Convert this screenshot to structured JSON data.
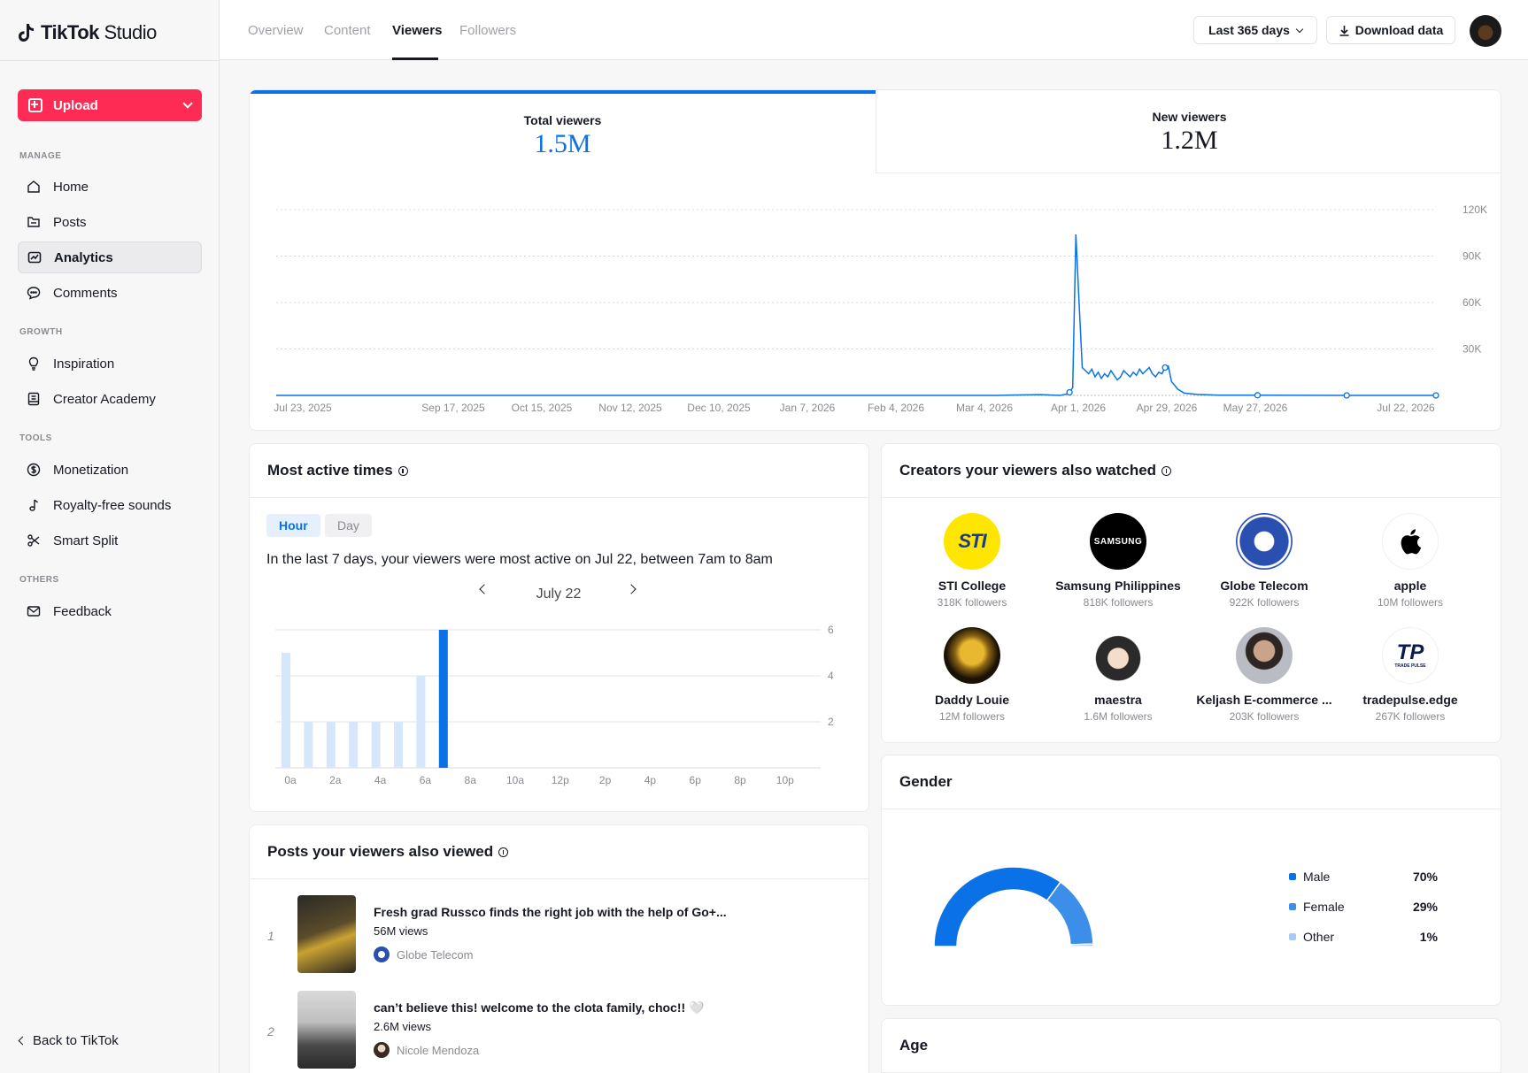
{
  "app": {
    "logo_text": "TikTok",
    "logo_suffix": "Studio"
  },
  "sidebar": {
    "upload_label": "Upload",
    "sections": {
      "manage": "MANAGE",
      "growth": "GROWTH",
      "tools": "TOOLS",
      "others": "OTHERS"
    },
    "items": {
      "home": "Home",
      "posts": "Posts",
      "analytics": "Analytics",
      "comments": "Comments",
      "inspiration": "Inspiration",
      "creator_academy": "Creator Academy",
      "monetization": "Monetization",
      "royalty_free_sounds": "Royalty-free sounds",
      "smart_split": "Smart Split",
      "feedback": "Feedback"
    },
    "back_label": "Back to TikTok"
  },
  "header": {
    "tabs": {
      "overview": "Overview",
      "content": "Content",
      "viewers": "Viewers",
      "followers": "Followers"
    },
    "active_tab": "Viewers",
    "range_label": "Last 365 days",
    "download_label": "Download data"
  },
  "metrics": {
    "total_viewers": {
      "label": "Total viewers",
      "value": "1.5M"
    },
    "new_viewers": {
      "label": "New viewers",
      "value": "1.2M"
    }
  },
  "colors": {
    "accent": "#fe2c55",
    "blue": "#0a72e6",
    "blue_light": "#3d8ee8",
    "blue_pale": "#d6e7fb"
  },
  "chart_data": [
    {
      "type": "line",
      "title": "",
      "y_ticks": [
        "120K",
        "90K",
        "60K",
        "30K"
      ],
      "ylim": [
        0,
        120000
      ],
      "x_tick_labels": [
        "Jul 23, 2025",
        "Sep 17, 2025",
        "Oct 15, 2025",
        "Nov 12, 2025",
        "Dec 10, 2025",
        "Jan 7, 2026",
        "Feb 4, 2026",
        "Mar 4, 2026",
        "Apr 1, 2026",
        "Apr 29, 2026",
        "May 27, 2026",
        "Jul 22, 2026"
      ],
      "x_start": "2025-07-23",
      "x_end": "2026-07-22",
      "series": [
        {
          "x": [
            "2025-07-23",
            "2026-03-06",
            "2026-03-20",
            "2026-03-26",
            "2026-03-28",
            "2026-03-29",
            "2026-03-30",
            "2026-03-31",
            "2026-04-01",
            "2026-04-02",
            "2026-04-03",
            "2026-04-04",
            "2026-04-05",
            "2026-04-06",
            "2026-04-07",
            "2026-04-08",
            "2026-04-09",
            "2026-04-10",
            "2026-04-11",
            "2026-04-12",
            "2026-04-13",
            "2026-04-14",
            "2026-04-15",
            "2026-04-16",
            "2026-04-17",
            "2026-04-18",
            "2026-04-19",
            "2026-04-20",
            "2026-04-21",
            "2026-04-22",
            "2026-04-23",
            "2026-04-24",
            "2026-04-25",
            "2026-04-26",
            "2026-04-27",
            "2026-04-28",
            "2026-04-29",
            "2026-04-30",
            "2026-05-02",
            "2026-05-04",
            "2026-05-08",
            "2026-05-15",
            "2026-05-27",
            "2026-06-24",
            "2026-07-22"
          ],
          "y": [
            0,
            0,
            500,
            0,
            800,
            2000,
            5000,
            104000,
            60000,
            18000,
            16000,
            14000,
            17000,
            12000,
            15000,
            11000,
            14000,
            12000,
            16000,
            13000,
            10000,
            12000,
            16000,
            14000,
            12000,
            15000,
            13000,
            17000,
            14000,
            16000,
            18000,
            14000,
            12000,
            15000,
            14000,
            18000,
            19000,
            9000,
            4000,
            1500,
            600,
            200,
            100,
            0,
            0
          ]
        }
      ]
    },
    {
      "type": "bar",
      "title": "",
      "y_ticks": [
        "6",
        "4",
        "2"
      ],
      "ylim": [
        0,
        6
      ],
      "x_tick_labels": [
        "0a",
        "2a",
        "4a",
        "6a",
        "8a",
        "10a",
        "12p",
        "2p",
        "4p",
        "6p",
        "8p",
        "10p"
      ],
      "categories": [
        "0",
        "1",
        "2",
        "3",
        "4",
        "5",
        "6",
        "7",
        "8",
        "9",
        "10",
        "11",
        "12",
        "13",
        "14",
        "15",
        "16",
        "17",
        "18",
        "19",
        "20",
        "21",
        "22",
        "23"
      ],
      "values": [
        5,
        2,
        2,
        2,
        2,
        2,
        4,
        6,
        0,
        0,
        0,
        0,
        0,
        0,
        0,
        0,
        0,
        0,
        0,
        0,
        0,
        0,
        0,
        0
      ],
      "highlight_index": 7
    },
    {
      "type": "pie",
      "title": "",
      "categories": [
        "Male",
        "Female",
        "Other"
      ],
      "values": [
        70,
        29,
        1
      ],
      "value_labels": [
        "70%",
        "29%",
        "1%"
      ],
      "colors": [
        "#0a72e6",
        "#3d8ee8",
        "#a9cbf3"
      ]
    }
  ],
  "active_times": {
    "title": "Most active times",
    "pills": {
      "hour": "Hour",
      "day": "Day"
    },
    "summary": "In the last 7 days, your viewers were most active on Jul 22, between 7am to 8am",
    "date_label": "July 22"
  },
  "creators": {
    "title": "Creators your viewers also watched",
    "items": [
      {
        "name": "STI College",
        "followers": "318K followers",
        "logo_text": "STI"
      },
      {
        "name": "Samsung Philippines",
        "followers": "818K followers",
        "logo_text": "SAMSUNG"
      },
      {
        "name": "Globe Telecom",
        "followers": "922K followers"
      },
      {
        "name": "apple",
        "followers": "10M followers"
      },
      {
        "name": "Daddy Louie",
        "followers": "12M followers"
      },
      {
        "name": "maestra",
        "followers": "1.6M followers"
      },
      {
        "name": "Keljash E-commerce ...",
        "followers": "203K followers"
      },
      {
        "name": "tradepulse.edge",
        "followers": "267K followers",
        "logo_text": "TRADE PULSE"
      }
    ]
  },
  "gender": {
    "title": "Gender"
  },
  "posts": {
    "title": "Posts your viewers also viewed",
    "items": [
      {
        "index": "1",
        "title": "Fresh grad Russco finds the right job with the help of Go+...",
        "views": "56M views",
        "author": "Globe Telecom"
      },
      {
        "index": "2",
        "title": "can’t believe this! welcome to the clota family, choc!! 🤍",
        "views": "2.6M views",
        "author": "Nicole Mendoza"
      }
    ]
  },
  "age": {
    "title": "Age"
  }
}
